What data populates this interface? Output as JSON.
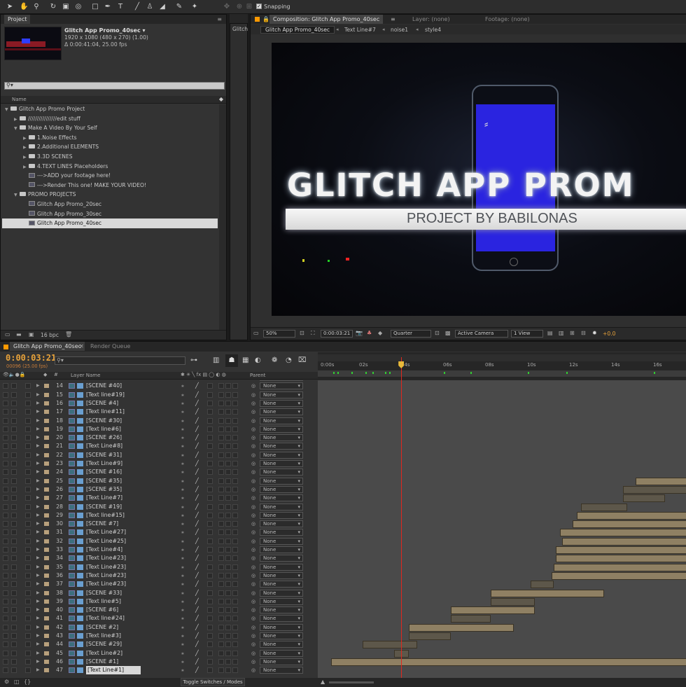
{
  "toolbar": {
    "snapping_label": "Snapping"
  },
  "project_panel": {
    "tab_label": "Project",
    "comp_name": "Glitch App Promo_40sec ▾",
    "comp_size": "1920 x 1080  (480 x 270) (1.00)",
    "comp_duration": "Δ 0:00:41:04, 25.00 fps",
    "search_placeholder": "",
    "column_name": "Name",
    "bpc": "16 bpc",
    "tree": [
      {
        "label": "Glitch App Promo Project",
        "type": "folder",
        "indent": 0,
        "open": true
      },
      {
        "label": "////////////////edit stuff",
        "type": "folder",
        "indent": 1,
        "open": false
      },
      {
        "label": "Make A Video By Your Self",
        "type": "folder",
        "indent": 1,
        "open": true
      },
      {
        "label": "1.Noise Effects",
        "type": "folder",
        "indent": 2,
        "open": false
      },
      {
        "label": "2.Additional ELEMENTS",
        "type": "folder",
        "indent": 2,
        "open": false
      },
      {
        "label": "3.3D SCENES",
        "type": "folder",
        "indent": 2,
        "open": false
      },
      {
        "label": "4.TEXT LINES Placeholders",
        "type": "folder",
        "indent": 2,
        "open": false
      },
      {
        "label": "--->ADD your footage here!",
        "type": "comp",
        "indent": 2
      },
      {
        "label": "--->Render This one! MAKE YOUR VIDEO!",
        "type": "comp",
        "indent": 2
      },
      {
        "label": "PROMO PROJECTS",
        "type": "folder",
        "indent": 1,
        "open": true
      },
      {
        "label": "Glitch App Promo_20sec",
        "type": "comp",
        "indent": 2
      },
      {
        "label": "Glitch App Promo_30sec",
        "type": "comp",
        "indent": 2
      },
      {
        "label": "Glitch App Promo_40sec",
        "type": "comp",
        "indent": 2,
        "selected": true
      }
    ]
  },
  "side_tab": "Glitch",
  "composition_panel": {
    "tab_label": "Composition: Glitch App Promo_40sec",
    "layer_tab": "Layer: (none)",
    "footage_tab": "Footage: (none)",
    "breadcrumbs": [
      "Glitch App Promo_40sec",
      "Text Line#7",
      "noise1",
      "style4"
    ],
    "viewer_title": "GLITCH APP PROM",
    "viewer_subtitle": "PROJECT BY BABILONAS",
    "zoom": "50%",
    "timecode": "0:00:03:21",
    "resolution": "Quarter",
    "camera": "Active Camera",
    "views": "1 View",
    "exposure": "+0.0"
  },
  "timeline": {
    "tab_label": "Glitch App Promo_40sec",
    "render_queue_label": "Render Queue",
    "current_time": "0:00:03:21",
    "frame_info": "00096 (25.00 fps)",
    "search_placeholder": "",
    "col_layer_name": "Layer Name",
    "col_parent": "Parent",
    "toggle_label": "Toggle Switches / Modes",
    "ruler": [
      "0:00s",
      "02s",
      "04s",
      "06s",
      "08s",
      "10s",
      "12s",
      "14s",
      "16s"
    ],
    "playhead_seconds": 3.84,
    "layers": [
      {
        "num": "13",
        "name": "[Text line#12]",
        "parent": "None"
      },
      {
        "num": "14",
        "name": "[SCENE #40]",
        "parent": "None"
      },
      {
        "num": "15",
        "name": "[Text line#19]",
        "parent": "None"
      },
      {
        "num": "16",
        "name": "[SCENE #4]",
        "parent": "None"
      },
      {
        "num": "17",
        "name": "[Text line#11]",
        "parent": "None"
      },
      {
        "num": "18",
        "name": "[SCENE #30]",
        "parent": "None"
      },
      {
        "num": "19",
        "name": "[Text line#6]",
        "parent": "None"
      },
      {
        "num": "20",
        "name": "[SCENE #26]",
        "parent": "None"
      },
      {
        "num": "21",
        "name": "[Text Line#8]",
        "parent": "None"
      },
      {
        "num": "22",
        "name": "[SCENE #31]",
        "parent": "None"
      },
      {
        "num": "23",
        "name": "[Text Line#9]",
        "parent": "None"
      },
      {
        "num": "24",
        "name": "[SCENE #16]",
        "parent": "None"
      },
      {
        "num": "25",
        "name": "[SCENE #35]",
        "parent": "None"
      },
      {
        "num": "26",
        "name": "[SCENE #35]",
        "parent": "None"
      },
      {
        "num": "27",
        "name": "[Text Line#7]",
        "parent": "None"
      },
      {
        "num": "28",
        "name": "[SCENE #19]",
        "parent": "None"
      },
      {
        "num": "29",
        "name": "[Text line#15]",
        "parent": "None"
      },
      {
        "num": "30",
        "name": "[SCENE #7]",
        "parent": "None"
      },
      {
        "num": "31",
        "name": "[Text Line#27]",
        "parent": "None"
      },
      {
        "num": "32",
        "name": "[Text Line#25]",
        "parent": "None"
      },
      {
        "num": "33",
        "name": "[Text Line#4]",
        "parent": "None"
      },
      {
        "num": "34",
        "name": "[Text Line#23]",
        "parent": "None"
      },
      {
        "num": "35",
        "name": "[Text Line#23]",
        "parent": "None"
      },
      {
        "num": "36",
        "name": "[Text Line#23]",
        "parent": "None"
      },
      {
        "num": "37",
        "name": "[Text Line#23]",
        "parent": "None"
      },
      {
        "num": "38",
        "name": "[SCENE #33]",
        "parent": "None"
      },
      {
        "num": "39",
        "name": "[Text line#5]",
        "parent": "None"
      },
      {
        "num": "40",
        "name": "[SCENE #6]",
        "parent": "None"
      },
      {
        "num": "41",
        "name": "[Text line#24]",
        "parent": "None"
      },
      {
        "num": "42",
        "name": "[SCENE #2]",
        "parent": "None"
      },
      {
        "num": "43",
        "name": "[Text line#3]",
        "parent": "None"
      },
      {
        "num": "44",
        "name": "[SCENE #29]",
        "parent": "None"
      },
      {
        "num": "45",
        "name": "[Text Line#2]",
        "parent": "None"
      },
      {
        "num": "46",
        "name": "[SCENE #1]",
        "parent": "None"
      },
      {
        "num": "47",
        "name": "[Text Line#1]",
        "parent": "None",
        "selected": true
      }
    ],
    "bars_seconds": [
      null,
      null,
      null,
      null,
      null,
      null,
      null,
      null,
      null,
      null,
      null,
      null,
      [
        15.0,
        17.5,
        true
      ],
      [
        14.4,
        17.5,
        false
      ],
      [
        14.4,
        16.4,
        false
      ],
      [
        12.4,
        14.6,
        false
      ],
      [
        12.2,
        17.5,
        true
      ],
      [
        12.0,
        17.5,
        true
      ],
      [
        11.4,
        17.5,
        true
      ],
      [
        11.5,
        17.5,
        true
      ],
      [
        11.2,
        17.5,
        true
      ],
      [
        11.2,
        17.5,
        true
      ],
      [
        11.1,
        17.5,
        true
      ],
      [
        11.0,
        17.5,
        true
      ],
      [
        10.0,
        11.1,
        false
      ],
      [
        8.1,
        13.5,
        true
      ],
      [
        8.1,
        10.2,
        false
      ],
      [
        6.2,
        10.2,
        true
      ],
      [
        6.2,
        8.1,
        false
      ],
      [
        4.2,
        9.2,
        true
      ],
      [
        4.2,
        6.2,
        false
      ],
      [
        2.0,
        4.6,
        false
      ],
      [
        3.5,
        4.2,
        false
      ],
      [
        0.5,
        17.5,
        true
      ]
    ]
  }
}
